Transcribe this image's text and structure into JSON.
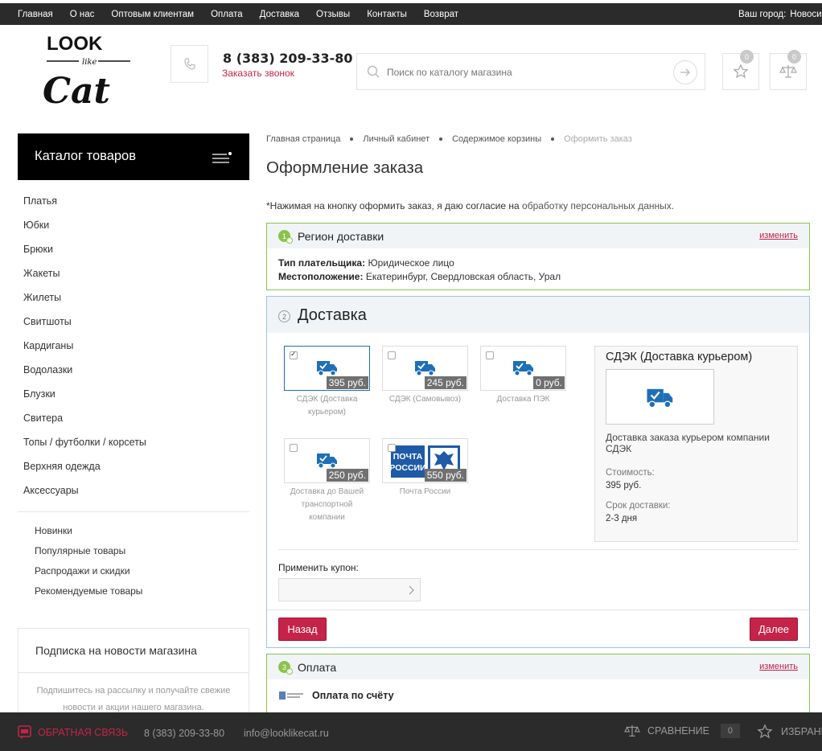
{
  "topbar": {
    "nav": [
      "Главная",
      "О нас",
      "Оптовым клиентам",
      "Оплата",
      "Доставка",
      "Отзывы",
      "Контакты",
      "Возврат"
    ],
    "city_label": "Ваш город:",
    "city_value": "Новосибирск"
  },
  "header": {
    "logo_text_top": "LOOK",
    "logo_text_mid": "like",
    "logo_text_bottom": "Cat",
    "phone": "8 (383) 209-33-80",
    "callback": "Заказать звонок",
    "search_placeholder": "Поиск по каталогу магазина",
    "favorites_count": "0",
    "compare_count": "0"
  },
  "sidebar": {
    "catalog_title": "Каталог товаров",
    "categories": [
      "Платья",
      "Юбки",
      "Брюки",
      "Жакеты",
      "Жилеты",
      "Свитшоты",
      "Кардиганы",
      "Водолазки",
      "Блузки",
      "Свитера",
      "Топы / футболки / корсеты",
      "Верхняя одежда",
      "Аксессуары"
    ],
    "links": [
      "Новинки",
      "Популярные товары",
      "Распродажи и скидки",
      "Рекомендуемые товары"
    ],
    "subscribe_title": "Подписка на новости магазина",
    "subscribe_desc": "Подпишитесь на рассылку и получайте свежие новости и акции нашего магазина."
  },
  "breadcrumb": [
    "Главная страница",
    "Личный кабинет",
    "Содержимое корзины",
    "Оформить заказ"
  ],
  "page_title": "Оформление заказа",
  "consent": {
    "text": "*Нажимая на кнопку оформить заказ, я даю согласие на ",
    "link": "обработку персональных данных."
  },
  "region": {
    "step": "1",
    "title": "Регион доставки",
    "edit": "изменить",
    "payer_label": "Тип плательщика:",
    "payer_value": "Юридическое лицо",
    "location_label": "Местоположение:",
    "location_value": "Екатеринбург, Свердловская область, Урал"
  },
  "delivery": {
    "step": "2",
    "title": "Доставка",
    "options": [
      {
        "label": "СДЭК (Доставка курьером)",
        "price": "395 руб.",
        "selected": true
      },
      {
        "label": "СДЭК (Самовывоз)",
        "price": "245 руб.",
        "selected": false
      },
      {
        "label": "Доставка ПЭК",
        "price": "0 руб.",
        "selected": false
      },
      {
        "label": "Доставка до Вашей транспортной компании",
        "price": "250 руб.",
        "selected": false
      },
      {
        "label": "Почта России",
        "price": "550 руб.",
        "selected": false
      }
    ],
    "pochta_logo_line1": "ПОЧТА",
    "pochta_logo_line2": "РОССИИ",
    "detail": {
      "title": "СДЭК (Доставка курьером)",
      "desc": "Доставка заказа курьером компании СДЭК",
      "cost_label": "Стоимость:",
      "cost_value": "395 руб.",
      "term_label": "Срок доставки:",
      "term_value": "2-3 дня"
    },
    "coupon_label": "Применить купон:",
    "coupon_value": "",
    "back_button": "Назад",
    "next_button": "Далее"
  },
  "payment": {
    "step": "3",
    "title": "Оплата",
    "edit": "изменить",
    "method": "Оплата по счёту"
  },
  "bottombar": {
    "feedback": "ОБРАТНАЯ СВЯЗЬ",
    "phone": "8 (383) 209-33-80",
    "email": "info@looklikecat.ru",
    "compare_label": "СРАВНЕНИЕ",
    "compare_count": "0",
    "favorites_label": "ИЗБРАННОЕ"
  },
  "colors": {
    "accent": "#c52448",
    "ok_green": "#8bc34a",
    "dark_bar": "#2b2b2b",
    "delivery_blue": "#1e6fb8"
  }
}
